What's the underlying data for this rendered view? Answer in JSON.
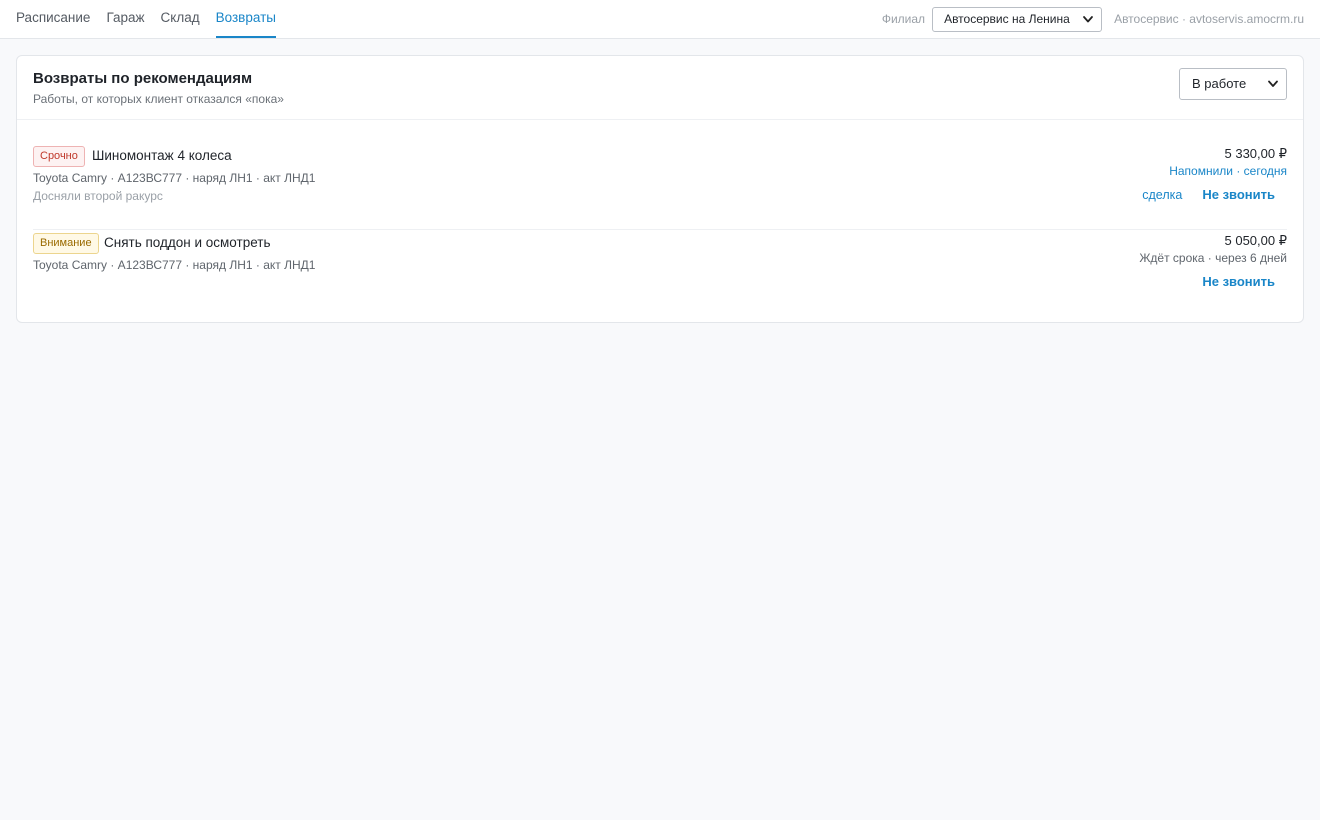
{
  "nav": {
    "items": [
      "Расписание",
      "Гараж",
      "Склад",
      "Возвраты"
    ],
    "active": "Возвраты"
  },
  "branch": {
    "label": "Филиал",
    "selected": "Автосервис на Ленина",
    "info": "Автосервис · avtoservis.amocrm.ru"
  },
  "card": {
    "title": "Возвраты по рекомендациям",
    "subtitle": "Работы, от которых клиент отказался «пока»",
    "status_filter": "В работе"
  },
  "items": [
    {
      "badge": "Срочно",
      "title": "Шиномонтаж 4 колеса",
      "meta": "Toyota Camry · А123ВС777 · наряд ЛН1 · акт ЛНД1",
      "note": "Досняли второй ракурс",
      "price": "5 330,00 ₽",
      "status": "Напомнили · сегодня",
      "deal_link": "сделка",
      "dont_call": "Не звонить"
    },
    {
      "badge": "Внимание",
      "title": "Снять поддон и осмотреть",
      "meta": "Toyota Camry · А123ВС777 · наряд ЛН1 · акт ЛНД1",
      "price": "5 050,00 ₽",
      "status": "Ждёт срока · через 6 дней",
      "dont_call": "Не звонить"
    }
  ],
  "colors": {
    "accent": "#1a86c8",
    "urgent": "#c0392b",
    "warning": "#9a6a00"
  }
}
